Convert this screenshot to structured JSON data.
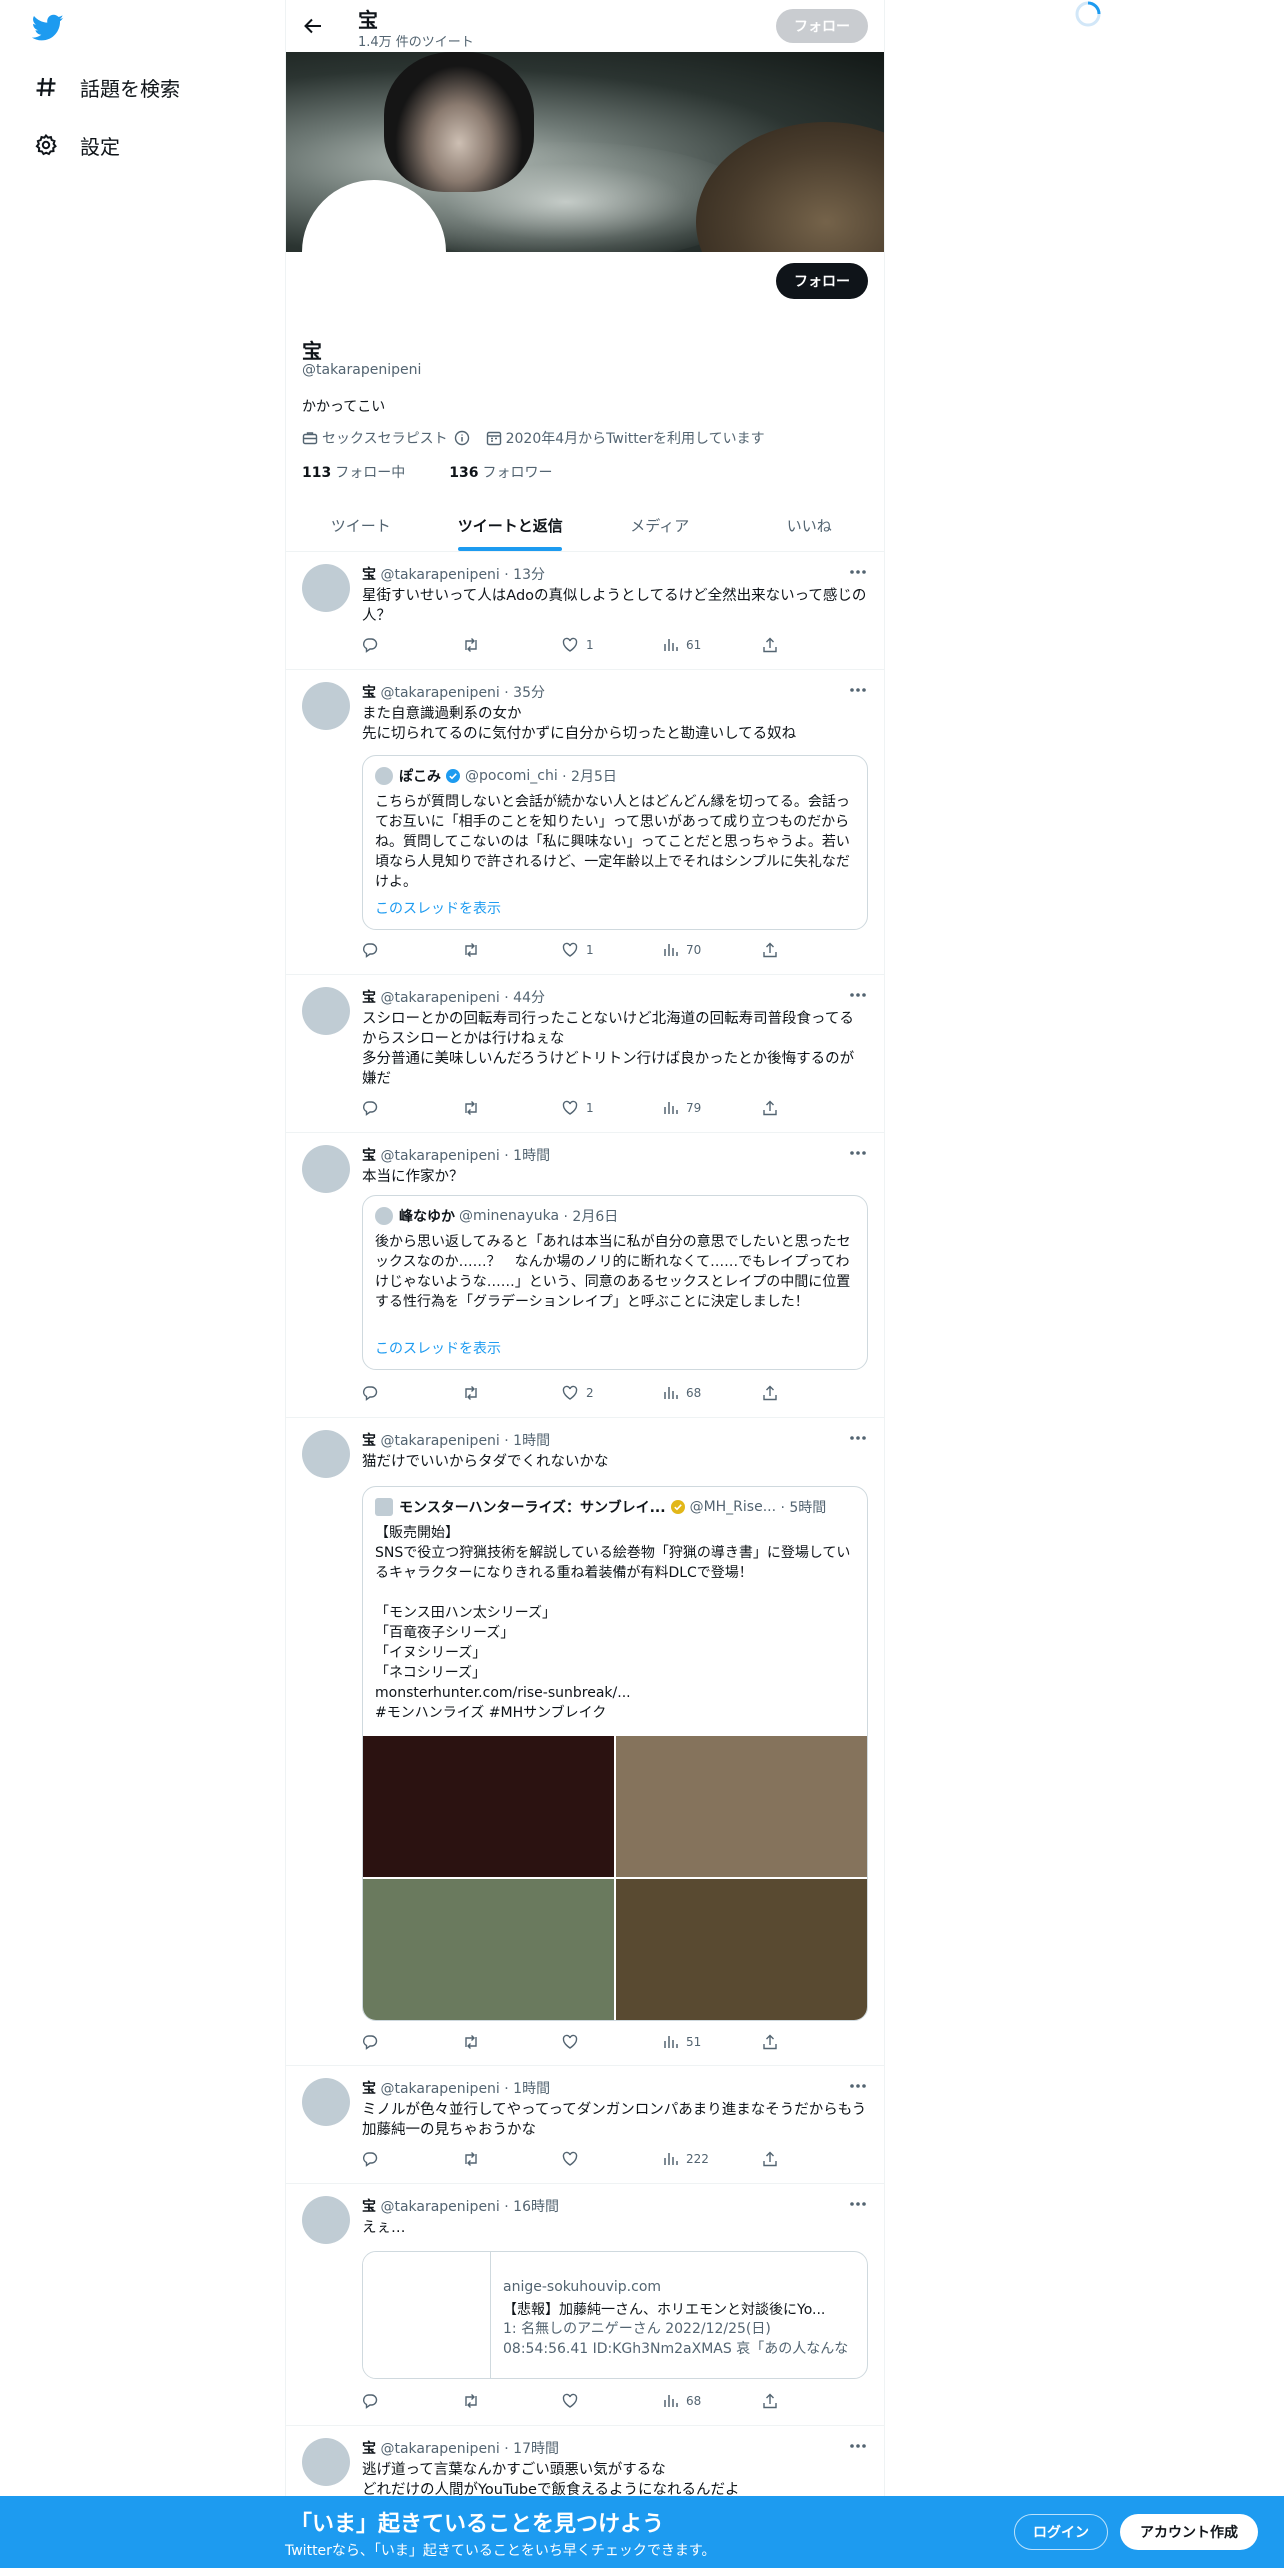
{
  "nav": {
    "items": [
      {
        "label": "話題を検索",
        "icon": "hashtag-icon"
      },
      {
        "label": "設定",
        "icon": "gear-icon"
      }
    ]
  },
  "topbar": {
    "name": "宝",
    "tweet_count": "1.4万 件のツイート",
    "follow_label": "フォロー"
  },
  "profile": {
    "name": "宝",
    "handle": "@takarapenipeni",
    "bio": "かかってこい",
    "job": "セックスセラピスト",
    "joined": "2020年4月からTwitterを利用しています",
    "following_count": "113",
    "following_label": "フォロー中",
    "followers_count": "136",
    "followers_label": "フォロワー",
    "follow_label": "フォロー"
  },
  "tabs": [
    {
      "label": "ツイート",
      "active": false
    },
    {
      "label": "ツイートと返信",
      "active": true
    },
    {
      "label": "メディア",
      "active": false
    },
    {
      "label": "いいね",
      "active": false
    }
  ],
  "tweets": [
    {
      "name": "宝",
      "handle": "@takarapenipeni",
      "time": "· 13分",
      "text": "星街すいせいって人はAdoの真似しようとしてるけど全然出来ないって感じの人？",
      "likes": "1",
      "views": "61"
    },
    {
      "name": "宝",
      "handle": "@takarapenipeni",
      "time": "· 35分",
      "text": "また自意識過剰系の女か\n先に切られてるのに気付かずに自分から切ったと勘違いしてる奴ね",
      "quote": {
        "name": "ぽこみ",
        "handle": "@pocomi_chi",
        "time": "· 2月5日",
        "text": "こちらが質問しないと会話が続かない人とはどんどん縁を切ってる。会話ってお互いに「相手のことを知りたい」って思いがあって成り立つものだからね。質問してこないのは「私に興味ない」ってことだと思っちゃうよ。若い頃なら人見知りで許されるけど、一定年齢以上でそれはシンプルに失礼なだけよ。",
        "thread": "このスレッドを表示"
      },
      "likes": "1",
      "views": "70"
    },
    {
      "name": "宝",
      "handle": "@takarapenipeni",
      "time": "· 44分",
      "text": "スシローとかの回転寿司行ったことないけど北海道の回転寿司普段食ってるからスシローとかは行けねぇな\n多分普通に美味しいんだろうけどトリトン行けば良かったとか後悔するのが嫌だ",
      "likes": "1",
      "views": "79"
    },
    {
      "name": "宝",
      "handle": "@takarapenipeni",
      "time": "· 1時間",
      "text": "本当に作家か？",
      "quote": {
        "name": "峰なゆか",
        "handle": "@minenayuka",
        "time": "· 2月6日",
        "text": "後から思い返してみると「あれは本当に私が自分の意思でしたいと思ったセックスなのか……？　なんか場のノリ的に断れなくて……でもレイプってわけじゃないような……」という、同意のあるセックスとレイプの中間に位置する性行為を「グラデーションレイプ」と呼ぶことに決定しました！",
        "thread": "このスレッドを表示"
      },
      "likes": "2",
      "views": "68"
    },
    {
      "name": "宝",
      "handle": "@takarapenipeni",
      "time": "· 1時間",
      "text": "猫だけでいいからタダでくれないかな",
      "quote": {
        "name": "モンスターハンターライズ：サンブレイ...",
        "handle": "@MH_Rise...",
        "time": "· 5時間",
        "text": "【販売開始】\nSNSで役立つ狩猟技術を解説している絵巻物「狩猟の導き書」に登場しているキャラクターになりきれる重ね着装備が有料DLCで登場！\n\n「モンス田ハン太シリーズ」\n「百竜夜子シリーズ」\n「イヌシリーズ」\n「ネコシリーズ」\nmonsterhunter.com/rise-sunbreak/...\n#モンハンライズ #MHサンブレイク",
        "media_colors": [
          "#2b1211",
          "#85735c",
          "#6a7a5e",
          "#594a31"
        ]
      },
      "likes": "",
      "views": "51"
    },
    {
      "name": "宝",
      "handle": "@takarapenipeni",
      "time": "· 1時間",
      "text": "ミノルが色々並行してやってってダンガンロンパあまり進まなそうだからもう加藤純一の見ちゃおうかな",
      "likes": "",
      "views": "222"
    },
    {
      "name": "宝",
      "handle": "@takarapenipeni",
      "time": "· 16時間",
      "text": "えぇ…",
      "card": {
        "domain": "anige-sokuhouvip.com",
        "title": "【悲報】加藤純一さん、ホリエモンと対談後にYo...",
        "desc": "1: 名無しのアニゲーさん 2022/12/25(日) 08:54:56.41 ID:KGh3Nm2aXMAS 哀「あの人なんなんスかｗ..."
      },
      "likes": "",
      "views": "68"
    },
    {
      "name": "宝",
      "handle": "@takarapenipeni",
      "time": "· 17時間",
      "text": "逃げ道って言葉なんかすごい頭悪い気がするな\nどれだけの人間がYouTubeで飯食えるようになれるんだよ"
    }
  ],
  "bottombar": {
    "title": "「いま」起きていることを見つけよう",
    "subtitle": "Twitterなら、「いま」起きていることをいち早くチェックできます。",
    "login": "ログイン",
    "signup": "アカウント作成"
  },
  "colors": {
    "accent": "#1d9bf0",
    "text": "#0f1419",
    "muted": "#536471",
    "border": "#eff3f4"
  }
}
